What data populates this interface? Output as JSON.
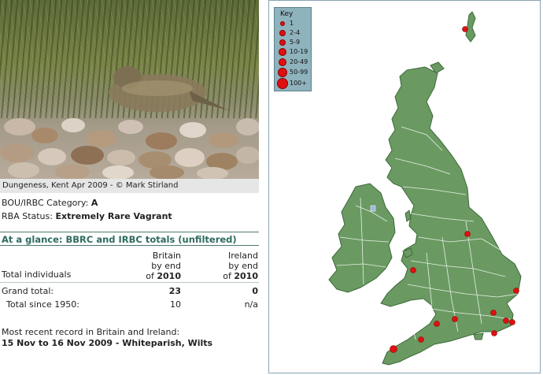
{
  "photo": {
    "caption": "Dungeness, Kent Apr 2009 - © Mark Stirland"
  },
  "status": {
    "category_label": "BOU/IRBC Category:",
    "category_value": "A",
    "rba_label": "RBA Status:",
    "rba_value": "Extremely Rare Vagrant"
  },
  "glance": {
    "heading": "At a glance: BBRC and IRBC totals (unfiltered)",
    "col_britain": [
      "Britain",
      "by end",
      "of"
    ],
    "col_britain_year": "2010",
    "col_ireland": [
      "Ireland",
      "by end",
      "of"
    ],
    "col_ireland_year": "2010",
    "row_label_total": "Total individuals",
    "grand_total_label": "Grand total:",
    "grand_total_britain": "23",
    "grand_total_ireland": "0",
    "since_label": "Total since 1950:",
    "since_britain": "10",
    "since_ireland": "n/a"
  },
  "recent": {
    "label": "Most recent record in Britain and Ireland:",
    "value": "15 Nov to 16 Nov 2009 - Whiteparish, Wilts"
  },
  "map_key": {
    "title": "Key",
    "items": [
      "1",
      "2-4",
      "5-9",
      "10-19",
      "20-49",
      "50-99",
      "100+"
    ]
  },
  "colors": {
    "land": "#6a9a62",
    "border": "#ffffff",
    "dot": "#e01010",
    "heading": "#2e6b5e",
    "key_bg": "#8fb3bd"
  }
}
